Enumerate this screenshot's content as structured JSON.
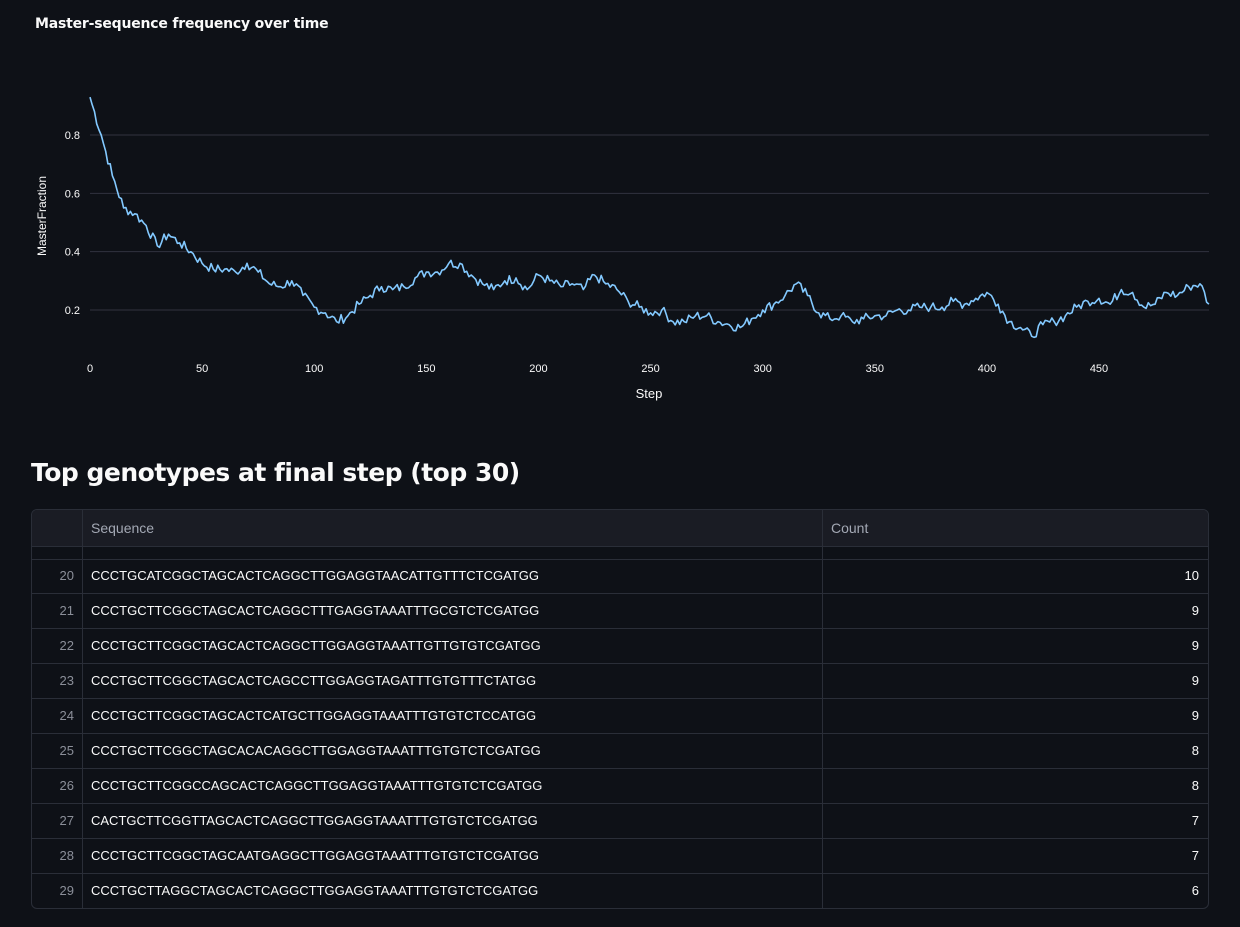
{
  "chart": {
    "title": "Master-sequence frequency over time",
    "line_color": "#83c9ff",
    "chart_data": {
      "type": "line",
      "title": "Master-sequence frequency over time",
      "xlabel": "Step",
      "ylabel": "MasterFraction",
      "xlim": [
        0,
        499
      ],
      "ylim": [
        0.1,
        0.95
      ],
      "xticks": [
        0,
        50,
        100,
        150,
        200,
        250,
        300,
        350,
        400,
        450
      ],
      "yticks": [
        0.2,
        0.4,
        0.6,
        0.8
      ],
      "grid": "horizontal",
      "series": [
        {
          "x": [
            0,
            5,
            10,
            15,
            20,
            25,
            30,
            35,
            40,
            45,
            50,
            55,
            60,
            65,
            70,
            75,
            80,
            85,
            90,
            95,
            100,
            105,
            110,
            115,
            120,
            125,
            130,
            135,
            140,
            145,
            150,
            155,
            160,
            165,
            170,
            175,
            180,
            185,
            190,
            195,
            200,
            205,
            210,
            215,
            220,
            225,
            230,
            235,
            240,
            245,
            250,
            255,
            260,
            265,
            270,
            275,
            280,
            285,
            290,
            295,
            300,
            305,
            310,
            315,
            320,
            325,
            330,
            335,
            340,
            345,
            350,
            355,
            360,
            365,
            370,
            375,
            380,
            385,
            390,
            395,
            400,
            405,
            410,
            415,
            420,
            425,
            430,
            435,
            440,
            445,
            450,
            455,
            460,
            465,
            470,
            475,
            480,
            485,
            490,
            495,
            499
          ],
          "y": [
            0.93,
            0.8,
            0.66,
            0.55,
            0.53,
            0.49,
            0.42,
            0.46,
            0.43,
            0.4,
            0.36,
            0.34,
            0.34,
            0.33,
            0.36,
            0.33,
            0.29,
            0.28,
            0.3,
            0.25,
            0.21,
            0.19,
            0.16,
            0.18,
            0.22,
            0.25,
            0.28,
            0.27,
            0.28,
            0.31,
            0.33,
            0.33,
            0.36,
            0.36,
            0.32,
            0.29,
            0.27,
            0.3,
            0.31,
            0.27,
            0.32,
            0.3,
            0.28,
            0.29,
            0.27,
            0.32,
            0.29,
            0.27,
            0.23,
            0.21,
            0.19,
            0.2,
            0.16,
            0.16,
            0.18,
            0.18,
            0.16,
            0.15,
            0.14,
            0.17,
            0.2,
            0.22,
            0.25,
            0.29,
            0.25,
            0.19,
            0.17,
            0.18,
            0.16,
            0.17,
            0.18,
            0.18,
            0.2,
            0.2,
            0.21,
            0.21,
            0.21,
            0.23,
            0.22,
            0.24,
            0.26,
            0.22,
            0.16,
            0.14,
            0.11,
            0.15,
            0.16,
            0.18,
            0.21,
            0.23,
            0.24,
            0.22,
            0.27,
            0.26,
            0.21,
            0.22,
            0.26,
            0.25,
            0.28,
            0.29,
            0.22
          ]
        }
      ]
    }
  },
  "section": {
    "title": "Top genotypes at final step (top 30)"
  },
  "table": {
    "columns": [
      "",
      "Sequence",
      "Count"
    ],
    "rows": [
      {
        "index": "20",
        "sequence": "CCCTGCATCGGCTAGCACTCAGGCTTGGAGGTAACATTGTTTCTCGATGG",
        "count": "10"
      },
      {
        "index": "21",
        "sequence": "CCCTGCTTCGGCTAGCACTCAGGCTTTGAGGTAAATTTGCGTCTCGATGG",
        "count": "9"
      },
      {
        "index": "22",
        "sequence": "CCCTGCTTCGGCTAGCACTCAGGCTTGGAGGTAAATTGTTGTGTCGATGG",
        "count": "9"
      },
      {
        "index": "23",
        "sequence": "CCCTGCTTCGGCTAGCACTCAGCCTTGGAGGTAGATTTGTGTTTCTATGG",
        "count": "9"
      },
      {
        "index": "24",
        "sequence": "CCCTGCTTCGGCTAGCACTCATGCTTGGAGGTAAATTTGTGTCTCCATGG",
        "count": "9"
      },
      {
        "index": "25",
        "sequence": "CCCTGCTTCGGCTAGCACACAGGCTTGGAGGTAAATTTGTGTCTCGATGG",
        "count": "8"
      },
      {
        "index": "26",
        "sequence": "CCCTGCTTCGGCCAGCACTCAGGCTTGGAGGTAAATTTGTGTCTCGATGG",
        "count": "8"
      },
      {
        "index": "27",
        "sequence": "CACTGCTTCGGTTAGCACTCAGGCTTGGAGGTAAATTTGTGTCTCGATGG",
        "count": "7"
      },
      {
        "index": "28",
        "sequence": "CCCTGCTTCGGCTAGCAATGAGGCTTGGAGGTAAATTTGTGTCTCGATGG",
        "count": "7"
      },
      {
        "index": "29",
        "sequence": "CCCTGCTTAGGCTAGCACTCAGGCTTGGAGGTAAATTTGTGTCTCGATGG",
        "count": "6"
      }
    ]
  }
}
